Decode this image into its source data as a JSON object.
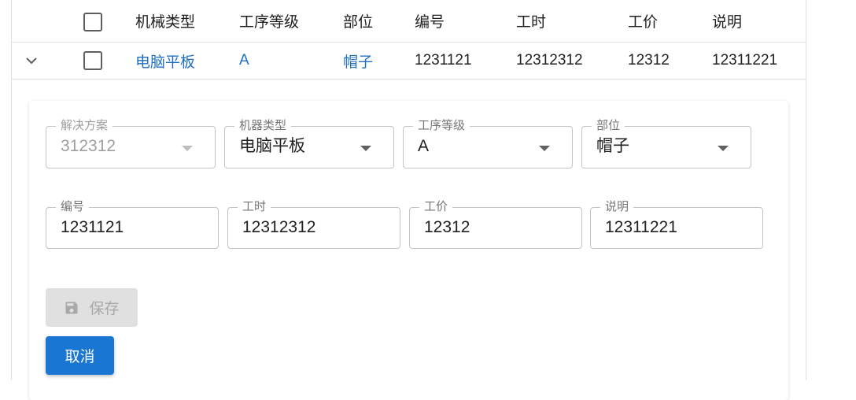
{
  "table": {
    "headers": {
      "machine_type": "机械类型",
      "process_level": "工序等级",
      "part": "部位",
      "code": "编号",
      "hours": "工时",
      "price": "工价",
      "note": "说明"
    },
    "row": {
      "machine_type": "电脑平板",
      "process_level": "A",
      "part": "帽子",
      "code": "1231121",
      "hours": "12312312",
      "price": "12312",
      "note": "12311221"
    }
  },
  "form": {
    "solution": {
      "label": "解决方案",
      "value": "312312"
    },
    "machine_type": {
      "label": "机器类型",
      "value": "电脑平板"
    },
    "process_level": {
      "label": "工序等级",
      "value": "A"
    },
    "part": {
      "label": "部位",
      "value": "帽子"
    },
    "code": {
      "label": "编号",
      "value": "1231121"
    },
    "hours": {
      "label": "工时",
      "value": "12312312"
    },
    "price": {
      "label": "工价",
      "value": "12312"
    },
    "note": {
      "label": "说明",
      "value": "12311221"
    }
  },
  "buttons": {
    "save": "保存",
    "cancel": "取消"
  },
  "colors": {
    "accent": "#1976d2",
    "link": "#1f6fc0",
    "disabled_bg": "#e0e0e0"
  },
  "icons": {
    "expand": "chevron-down-icon",
    "save": "floppy-disk-icon",
    "dropdown": "caret-down-icon"
  }
}
